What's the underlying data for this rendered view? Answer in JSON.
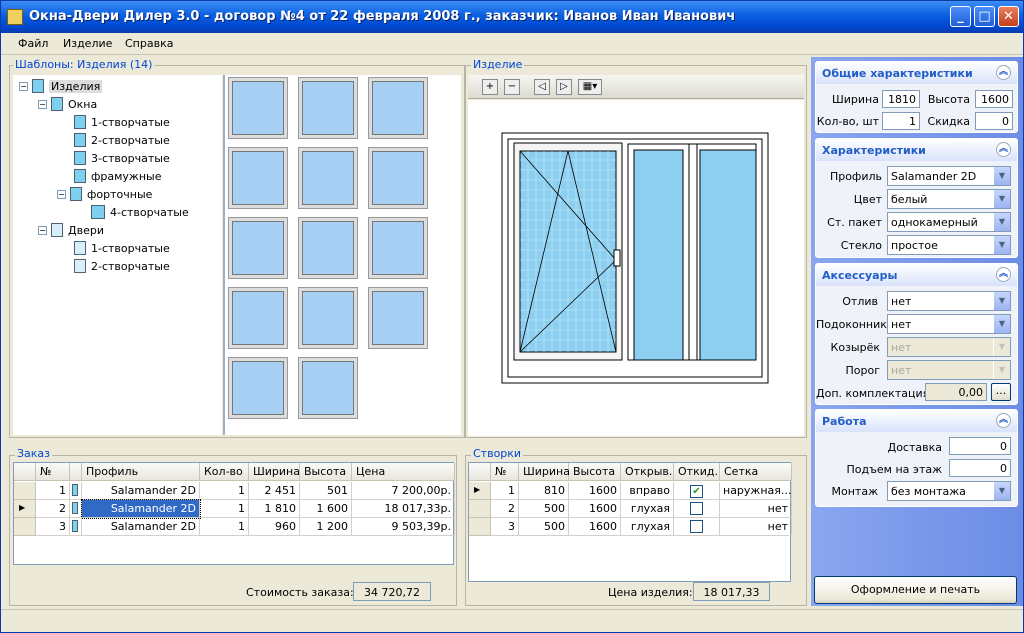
{
  "window": {
    "title": "Окна-Двери Дилер 3.0 - договор №4 от 22 февраля 2008 г., заказчик: Иванов Иван Иванович",
    "min_icon": "minimize-icon",
    "max_icon": "maximize-icon",
    "close_icon": "close-icon"
  },
  "menu": [
    "Файл",
    "Изделие",
    "Справка"
  ],
  "templates": {
    "title": "Шаблоны: Изделия (14)",
    "tree": {
      "root": "Изделия",
      "windows": "Окна",
      "win_items": [
        "1-створчатые",
        "2-створчатые",
        "3-створчатые",
        "фрамужные",
        "форточные"
      ],
      "fortochnye_child": "4-створчатые",
      "doors": "Двери",
      "door_items": [
        "1-створчатые",
        "2-створчатые"
      ]
    }
  },
  "product": {
    "title": "Изделие"
  },
  "general": {
    "title": "Общие характеристики",
    "width_label": "Ширина",
    "width": "1810",
    "height_label": "Высота",
    "height": "1600",
    "qty_label": "Кол-во, шт",
    "qty": "1",
    "discount_label": "Скидка",
    "discount": "0"
  },
  "characteristics": {
    "title": "Характеристики",
    "profile_label": "Профиль",
    "profile": "Salamander 2D",
    "color_label": "Цвет",
    "color": "белый",
    "glazing_label": "Ст. пакет",
    "glazing": "однокамерный",
    "glass_label": "Стекло",
    "glass": "простое"
  },
  "accessories": {
    "title": "Аксессуары",
    "sill_label": "Отлив",
    "sill": "нет",
    "windowsill_label": "Подоконник",
    "windowsill": "нет",
    "visor_label": "Козырёк",
    "visor": "нет",
    "threshold_label": "Порог",
    "threshold": "нет",
    "extra_label": "Доп. комплектация",
    "extra": "0,00",
    "extra_btn": "..."
  },
  "work": {
    "title": "Работа",
    "delivery_label": "Доставка",
    "delivery": "0",
    "lift_label": "Подъем на этаж",
    "lift": "0",
    "mount_label": "Монтаж",
    "mount": "без монтажа"
  },
  "order": {
    "title": "Заказ",
    "headers": [
      "№",
      "Профиль",
      "Кол-во",
      "Ширина",
      "Высота",
      "Цена"
    ],
    "rows": [
      {
        "n": "1",
        "profile": "Salamander 2D",
        "qty": "1",
        "width": "2 451",
        "height": "501",
        "price": "7 200,00р."
      },
      {
        "n": "2",
        "profile": "Salamander 2D",
        "qty": "1",
        "width": "1 810",
        "height": "1 600",
        "price": "18 017,33р."
      },
      {
        "n": "3",
        "profile": "Salamander 2D",
        "qty": "1",
        "width": "960",
        "height": "1 200",
        "price": "9 503,39р."
      }
    ],
    "total_label": "Стоимость заказа:",
    "total": "34 720,72"
  },
  "sashes": {
    "title": "Створки",
    "headers": [
      "№",
      "Ширина",
      "Высота",
      "Открыв.",
      "Откид.",
      "Сетка"
    ],
    "rows": [
      {
        "n": "1",
        "width": "810",
        "height": "1600",
        "open": "вправо",
        "tilt": true,
        "net": "наружная..."
      },
      {
        "n": "2",
        "width": "500",
        "height": "1600",
        "open": "глухая",
        "tilt": false,
        "net": "нет"
      },
      {
        "n": "3",
        "width": "500",
        "height": "1600",
        "open": "глухая",
        "tilt": false,
        "net": "нет"
      }
    ],
    "price_label": "Цена изделия:",
    "price": "18 017,33"
  },
  "print_button": "Оформление и печать документов",
  "colors": {
    "accent": "#0046d5",
    "glass": "#a8d0f4",
    "titlebar": "#0a5fe0"
  }
}
